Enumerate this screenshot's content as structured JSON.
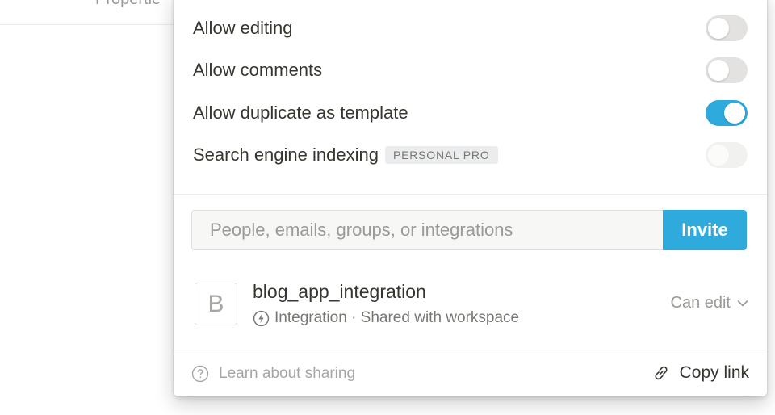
{
  "background": {
    "partial_tab_text": "Propertie"
  },
  "share_panel": {
    "options": [
      {
        "label": "Allow editing",
        "enabled": false,
        "disabled": false
      },
      {
        "label": "Allow comments",
        "enabled": false,
        "disabled": false
      },
      {
        "label": "Allow duplicate as template",
        "enabled": true,
        "disabled": false
      },
      {
        "label": "Search engine indexing",
        "enabled": false,
        "disabled": true,
        "badge": "PERSONAL PRO"
      }
    ],
    "invite": {
      "placeholder": "People, emails, groups, or integrations",
      "button_label": "Invite"
    },
    "member": {
      "avatar_letter": "B",
      "name": "blog_app_integration",
      "type_icon": "bolt-circle-icon",
      "subtitle": "Integration · Shared with workspace",
      "role": "Can edit"
    },
    "footer": {
      "help_icon": "question-circle-icon",
      "learn_label": "Learn about sharing",
      "link_icon": "link-icon",
      "copy_link_label": "Copy link"
    },
    "colors": {
      "accent": "#2eaadc",
      "toggle_off": "#e3e2e0",
      "toggle_disabled": "#f1f1ef",
      "text": "#37352f",
      "muted": "#9b9a97"
    }
  }
}
